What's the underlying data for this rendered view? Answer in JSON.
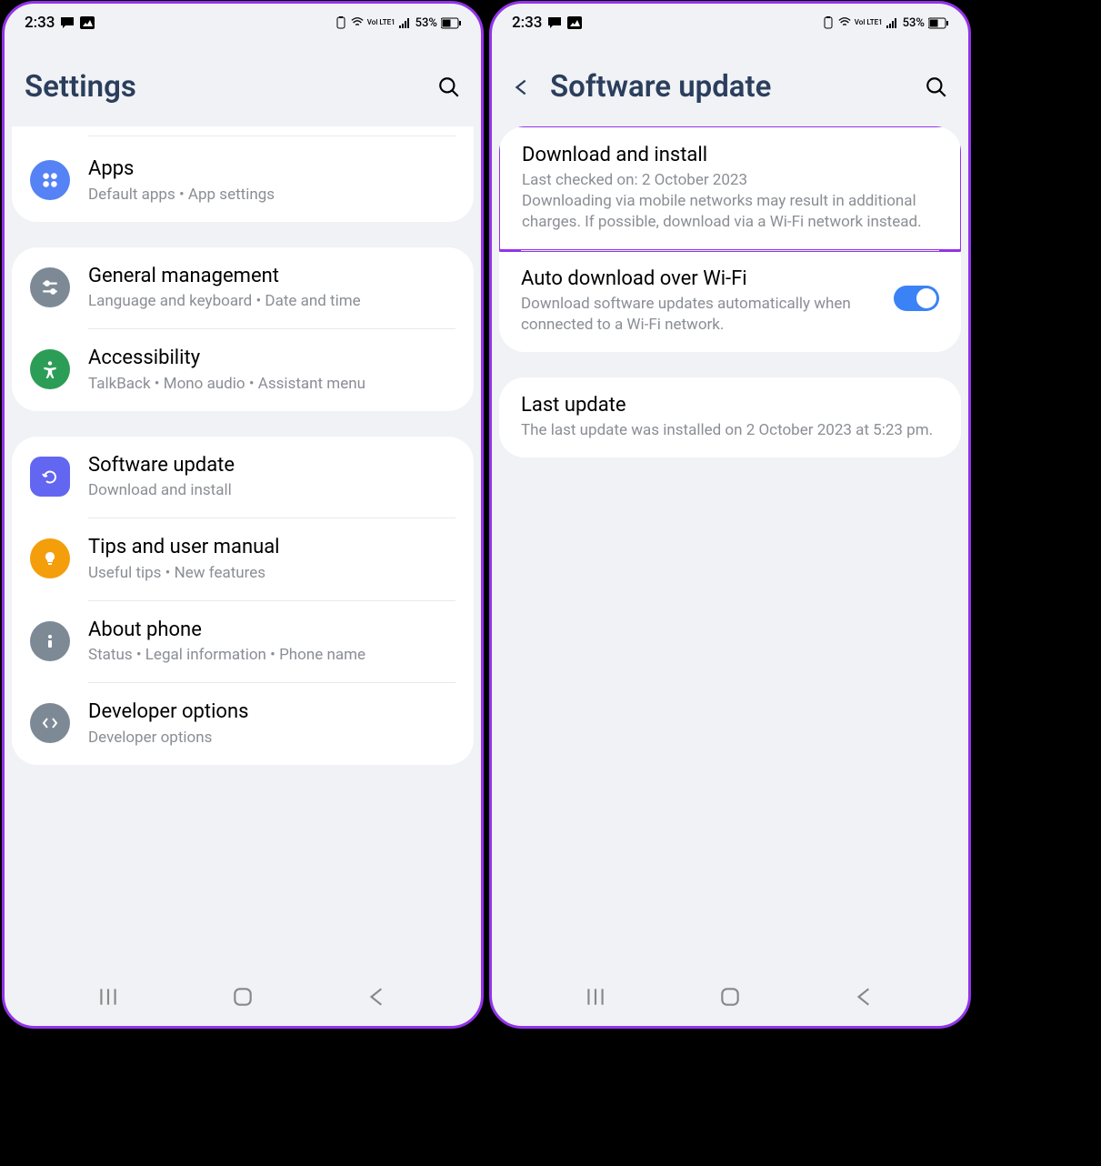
{
  "status": {
    "time": "2:33",
    "battery_pct": "53%",
    "volte": "Vol LTE1"
  },
  "screen1": {
    "title": "Settings",
    "groups": [
      {
        "items": [
          {
            "id": "apps",
            "title": "Apps",
            "sub": "Default apps  •  App settings",
            "color": "#5582f5"
          }
        ]
      },
      {
        "items": [
          {
            "id": "general",
            "title": "General management",
            "sub": "Language and keyboard  •  Date and time",
            "color": "#7d8a96"
          },
          {
            "id": "accessibility",
            "title": "Accessibility",
            "sub": "TalkBack  •  Mono audio  •  Assistant menu",
            "color": "#2b9d57"
          }
        ]
      },
      {
        "items": [
          {
            "id": "software",
            "title": "Software update",
            "sub": "Download and install",
            "color": "#6366f1"
          },
          {
            "id": "tips",
            "title": "Tips and user manual",
            "sub": "Useful tips  •  New features",
            "color": "#f59e0b"
          },
          {
            "id": "about",
            "title": "About phone",
            "sub": "Status  •  Legal information  •  Phone name",
            "color": "#7d8a96"
          },
          {
            "id": "developer",
            "title": "Developer options",
            "sub": "Developer options",
            "color": "#7d8a96"
          }
        ]
      }
    ]
  },
  "screen2": {
    "title": "Software update",
    "items": [
      {
        "id": "download",
        "title": "Download and install",
        "sub": "Last checked on: 2 October 2023\nDownloading via mobile networks may result in additional charges. If possible, download via a Wi-Fi network instead.",
        "highlighted": true
      },
      {
        "id": "auto",
        "title": "Auto download over Wi-Fi",
        "sub": "Download software updates automatically when connected to a Wi-Fi network.",
        "toggle": true
      },
      {
        "id": "last",
        "title": "Last update",
        "sub": "The last update was installed on 2 October 2023 at 5:23 pm."
      }
    ]
  }
}
